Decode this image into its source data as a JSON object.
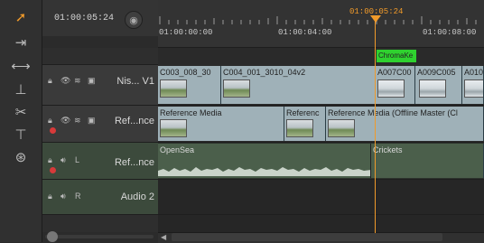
{
  "header": {
    "current_timecode": "01:00:05:24"
  },
  "ruler": {
    "labels": [
      "01:00:00:00",
      "01:00:04:00",
      "01:00:08:00"
    ],
    "playhead_timecode": "01:00:05:24"
  },
  "tracks": [
    {
      "name": "Nis... V1",
      "type": "video"
    },
    {
      "name": "Ref...nce",
      "type": "video"
    },
    {
      "name": "Ref...nce",
      "type": "audio",
      "channel": "L"
    },
    {
      "name": "Audio 2",
      "type": "audio",
      "channel": "R"
    }
  ],
  "clips": {
    "v1": [
      "C003_008_30",
      "C004_001_3010_04v2",
      "A007C00",
      "A009C005",
      "A010"
    ],
    "effect": "ChromaKe",
    "ref": [
      "Reference Media",
      "Referenc",
      "Reference Media (Offline Master (Cl"
    ],
    "audio": [
      "OpenSea",
      "Crickets"
    ]
  },
  "colors": {
    "playhead": "#f09a2a",
    "video_clip": "#9fb1b8",
    "audio_clip": "#4b5f4b",
    "effect_clip": "#2fd12f"
  }
}
